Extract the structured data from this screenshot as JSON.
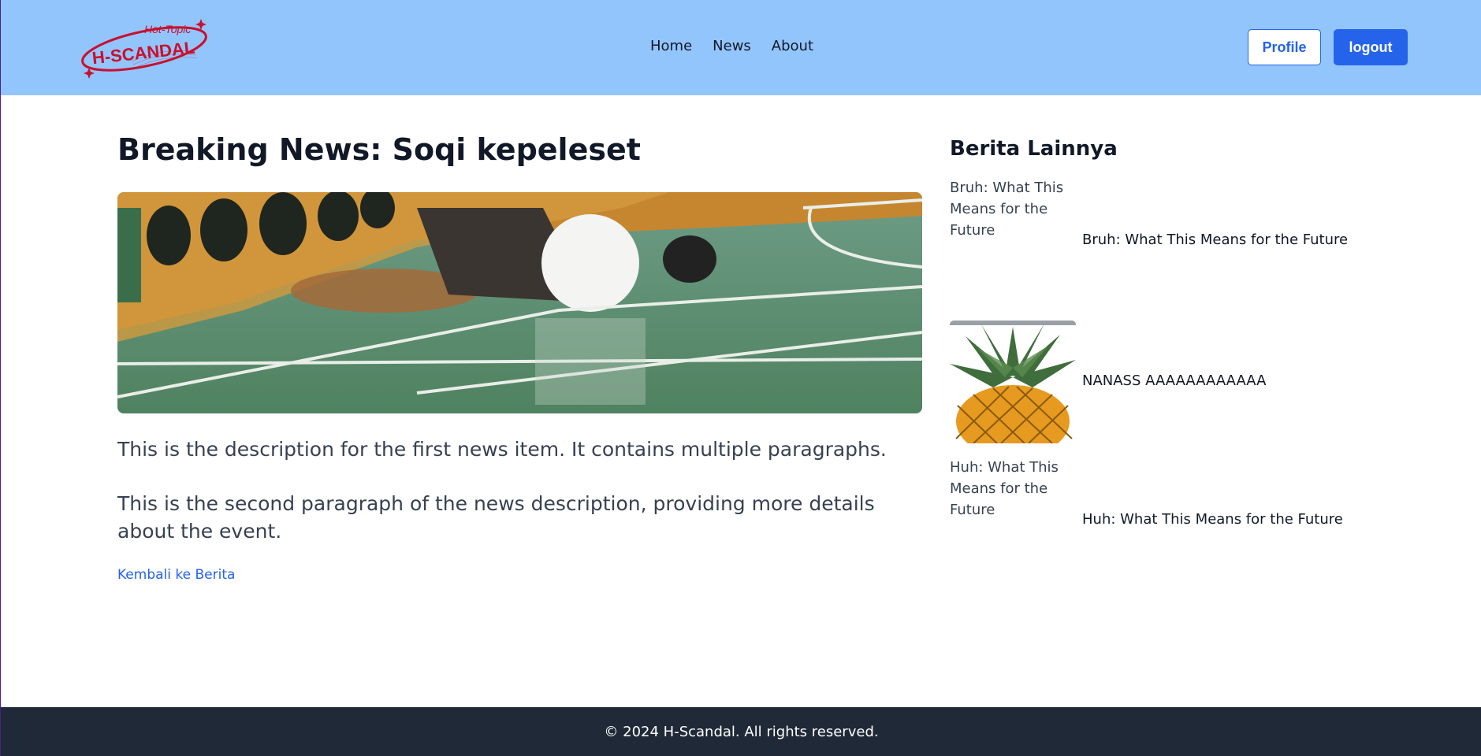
{
  "brand": {
    "logo_text_top": "Hot-Topic",
    "logo_text_main": "H-SCANDAL",
    "accent": "#c8102e"
  },
  "nav": {
    "links": [
      "Home",
      "News",
      "About"
    ]
  },
  "auth": {
    "profile_label": "Profile",
    "logout_label": "logout"
  },
  "article": {
    "title": "Breaking News: Soqi kepeleset",
    "image_alt": "Soqi kepeleset",
    "paragraphs": [
      "This is the description for the first news item. It contains multiple paragraphs.",
      "This is the second paragraph of the news description, providing more details about the event."
    ],
    "back_link": "Kembali ke Berita"
  },
  "sidebar": {
    "title": "Berita Lainnya",
    "items": [
      {
        "label": "Bruh: What This Means for the Future",
        "image_alt": "Bruh: What This Means for the Future",
        "image_loaded": false
      },
      {
        "label": "NANASS AAAAAAAAAAAA",
        "image_alt": "",
        "image_loaded": true
      },
      {
        "label": "Huh: What This Means for the Future",
        "image_alt": "Huh: What This Means for the Future",
        "image_loaded": false
      }
    ]
  },
  "footer": {
    "copyright": "© 2024 H-Scandal. All rights reserved."
  },
  "colors": {
    "header_bg": "#93c5fd",
    "primary": "#2563eb",
    "footer_bg": "#1f2937"
  }
}
